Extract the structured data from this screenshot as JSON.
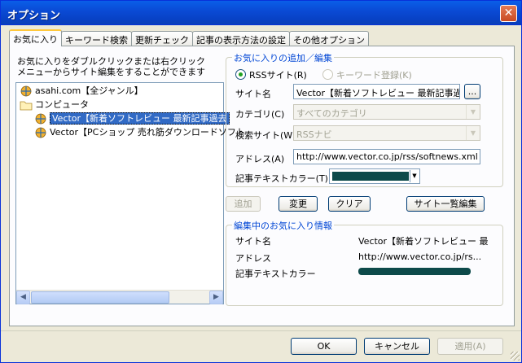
{
  "window": {
    "title": "オプション"
  },
  "tabs": [
    "お気に入り",
    "キーワード検索",
    "更新チェック",
    "記事の表示方法の設定",
    "その他オプション"
  ],
  "instructions": [
    "お気に入りをダブルクリックまたは右クリック",
    "メニューからサイト編集をすることができます"
  ],
  "tree": {
    "root": "asahi.com【全ジャンル】",
    "folder": "コンピュータ",
    "items": [
      "Vector【新着ソフトレビュー 最新記事過去",
      "Vector【PCショップ 売れ筋ダウンロードソフト"
    ]
  },
  "add_edit": {
    "title": "お気に入りの追加／編集",
    "rss_label": "RSSサイト(R)",
    "keyword_label": "キーワード登録(K)",
    "site_name_label": "サイト名",
    "site_name_value": "Vector【新着ソフトレビュー 最新記事過去",
    "browse_label": "...",
    "category_label": "カテゴリ(C)",
    "category_value": "すべてのカテゴリ",
    "search_site_label": "検索サイト(W)",
    "search_site_value": "RSSナビ",
    "address_label": "アドレス(A)",
    "address_value": "http://www.vector.co.jp/rss/softnews.xml",
    "text_color_label": "記事テキストカラー(T)",
    "text_color": "#0d4a4a"
  },
  "buttons": {
    "add": "追加",
    "change": "変更",
    "clear": "クリア",
    "site_list_edit": "サイト一覧編集",
    "ok": "OK",
    "cancel": "キャンセル",
    "apply": "適用(A)"
  },
  "info": {
    "title": "編集中のお気に入り情報",
    "site_name_label": "サイト名",
    "site_name_value": "Vector【新着ソフトレビュー 最",
    "address_label": "アドレス",
    "address_value": "http://www.vector.co.jp/rs...",
    "color_label": "記事テキストカラー"
  },
  "icons": {
    "close": "close-icon",
    "globe": "rss-globe-icon",
    "folder": "folder-icon",
    "arrow_left": "arrow-left-icon",
    "arrow_right": "arrow-right-icon",
    "chevron_down": "chevron-down-icon"
  }
}
